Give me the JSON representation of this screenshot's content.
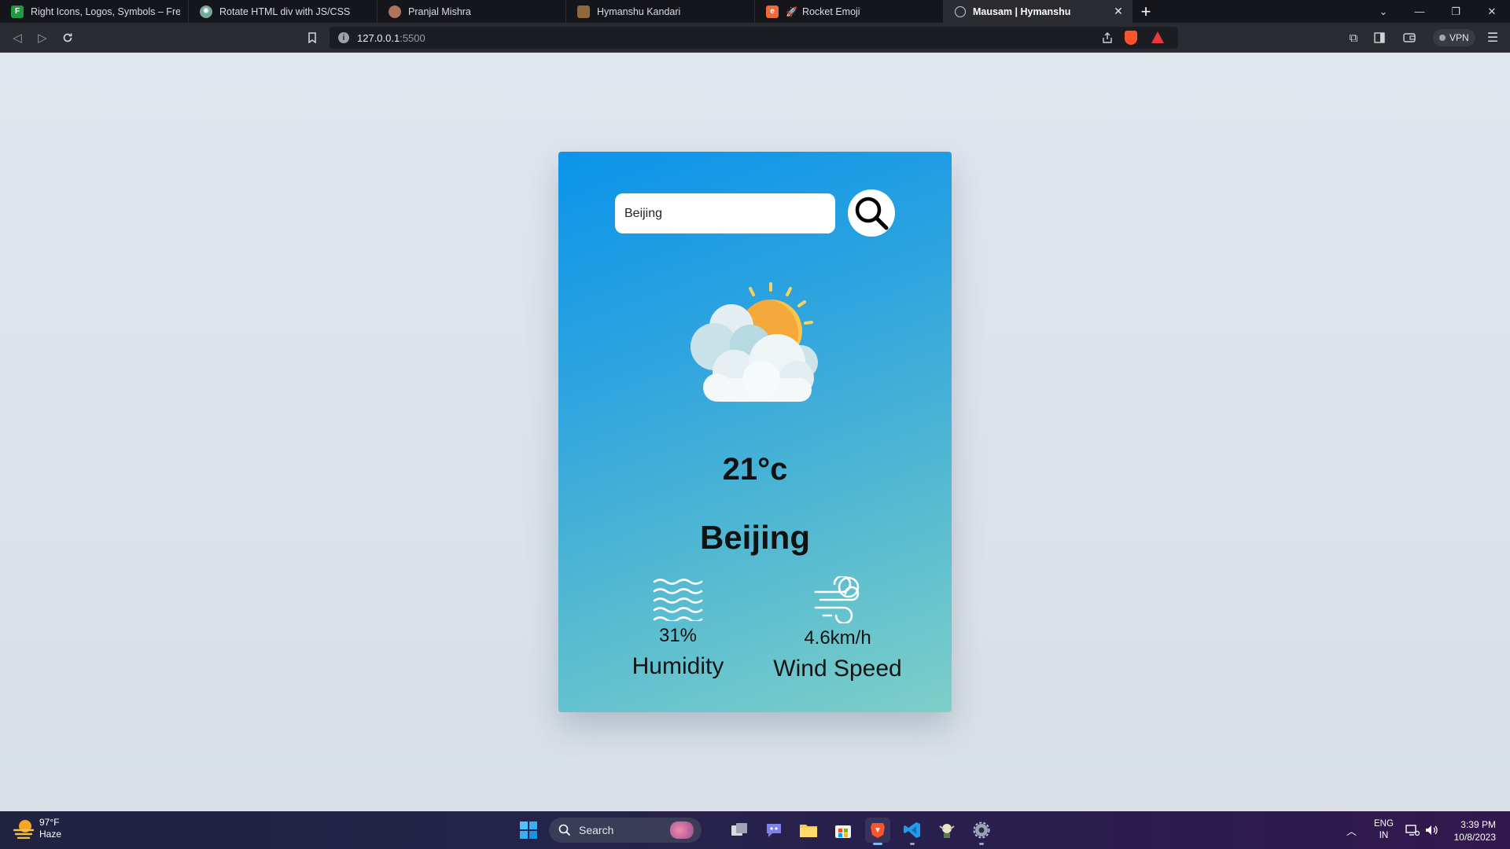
{
  "browser": {
    "tabs": [
      {
        "title": "Right Icons, Logos, Symbols – Free Do",
        "icon": "flaticon-icon",
        "color": "#1f9c41"
      },
      {
        "title": "Rotate HTML div with JS/CSS",
        "icon": "chatgpt-icon",
        "color": "#74aa9c"
      },
      {
        "title": "Pranjal Mishra",
        "icon": "profile-avatar-icon",
        "color": "#b0745a"
      },
      {
        "title": "Hymanshu Kandari",
        "icon": "profile-avatar-icon",
        "color": "#8c6a3e"
      },
      {
        "title": "Rocket Emoji",
        "icon": "emojipedia-icon",
        "color": "#f1683a"
      },
      {
        "title": "Mausam | Hymanshu",
        "icon": "globe-icon",
        "color": "#9aa0a6",
        "active": true
      }
    ],
    "address": {
      "host": "127.0.0.1",
      "port": ":5500"
    },
    "vpn_label": "VPN"
  },
  "app": {
    "search": {
      "value": "Beijing"
    },
    "temperature": "21°c",
    "city": "Beijing",
    "humidity": {
      "value": "31%",
      "label": "Humidity"
    },
    "wind": {
      "value": "4.6km/h",
      "label": "Wind Speed"
    },
    "colors": {
      "card_top": "#0a94ea",
      "card_bottom": "#7dcfc8"
    }
  },
  "taskbar": {
    "weather": {
      "temp": "97°F",
      "condition": "Haze"
    },
    "search_label": "Search",
    "language": {
      "line1": "ENG",
      "line2": "IN"
    },
    "time": "3:39 PM",
    "date": "10/8/2023"
  }
}
